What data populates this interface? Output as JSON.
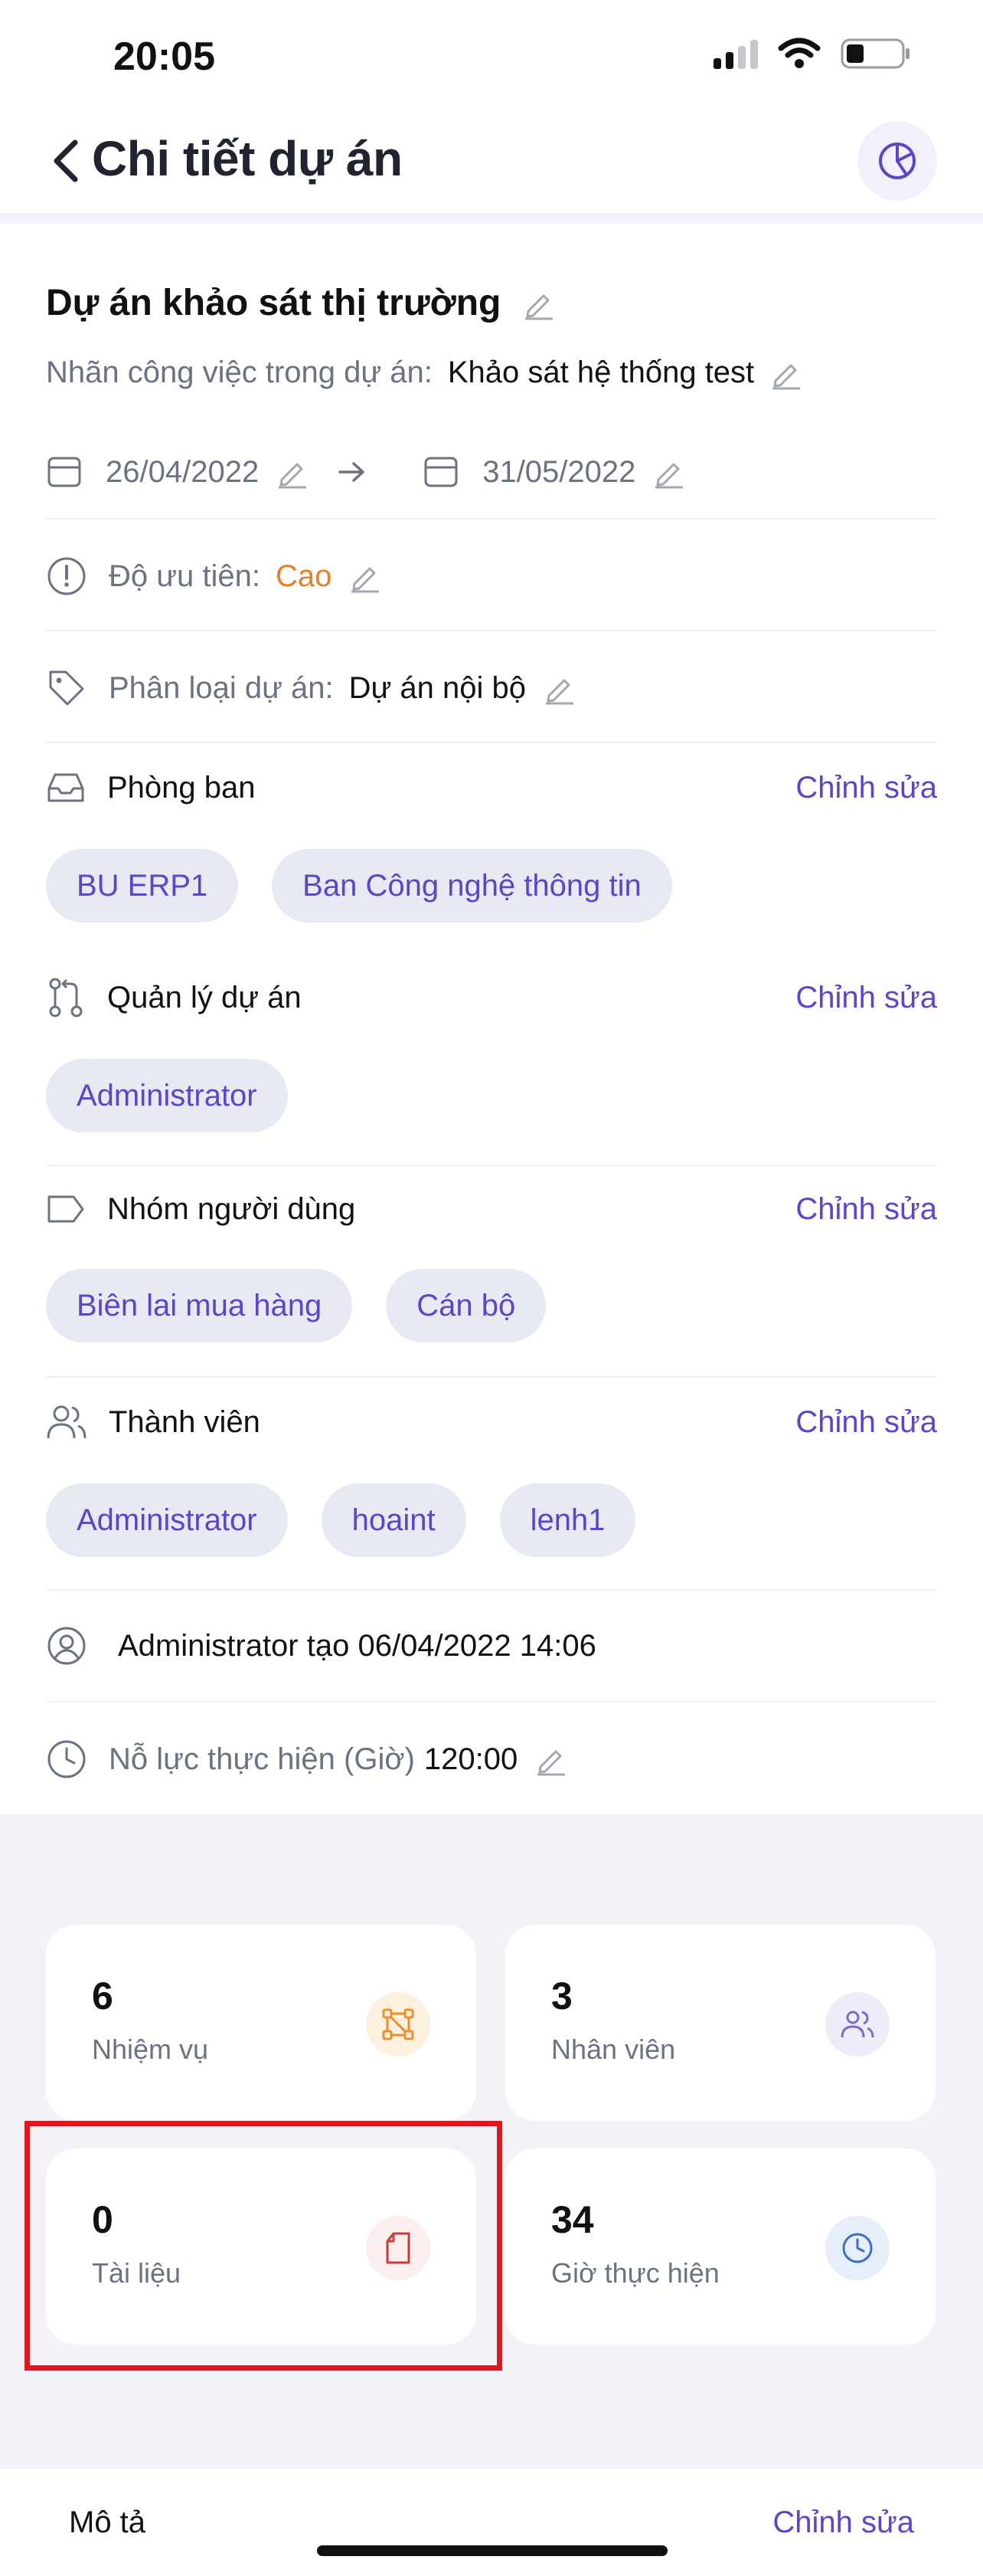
{
  "status_bar": {
    "time": "20:05"
  },
  "header": {
    "title": "Chi tiết dự án"
  },
  "project": {
    "title": "Dự án khảo sát thị trường",
    "label_caption": "Nhãn công việc trong dự án:",
    "label_value": "Khảo sát hệ thống test",
    "start_date": "26/04/2022",
    "end_date": "31/05/2022",
    "priority_caption": "Độ ưu tiên:",
    "priority_value": "Cao",
    "category_caption": "Phân loại dự án:",
    "category_value": "Dự án nội bộ",
    "creator_text": "Administrator tạo 06/04/2022 14:06",
    "effort_caption": "Nỗ lực thực hiện (Giờ)",
    "effort_value": "120:00"
  },
  "sections": {
    "departments": {
      "title": "Phòng ban",
      "edit_label": "Chỉnh sửa",
      "chips": [
        "BU ERP1",
        "Ban Công nghệ thông tin"
      ]
    },
    "managers": {
      "title": "Quản lý dự án",
      "edit_label": "Chỉnh sửa",
      "chips": [
        "Administrator"
      ]
    },
    "user_groups": {
      "title": "Nhóm người dùng",
      "edit_label": "Chỉnh sửa",
      "chips": [
        "Biên lai mua hàng",
        "Cán bộ"
      ]
    },
    "members": {
      "title": "Thành viên",
      "edit_label": "Chỉnh sửa",
      "chips": [
        "Administrator",
        "hoaint",
        "lenh1"
      ]
    }
  },
  "stats": [
    {
      "value": "6",
      "label": "Nhiệm vụ",
      "icon": "task-flow-icon"
    },
    {
      "value": "3",
      "label": "Nhân viên",
      "icon": "people-icon"
    },
    {
      "value": "0",
      "label": "Tài liệu",
      "icon": "document-icon"
    },
    {
      "value": "34",
      "label": "Giờ thực hiện",
      "icon": "clock-icon"
    }
  ],
  "bottom": {
    "description_label": "Mô tả",
    "edit_label": "Chỉnh sửa"
  },
  "colors": {
    "accent": "#5b45c9",
    "priority": "#e47f2a",
    "highlight": "#e8141b"
  }
}
